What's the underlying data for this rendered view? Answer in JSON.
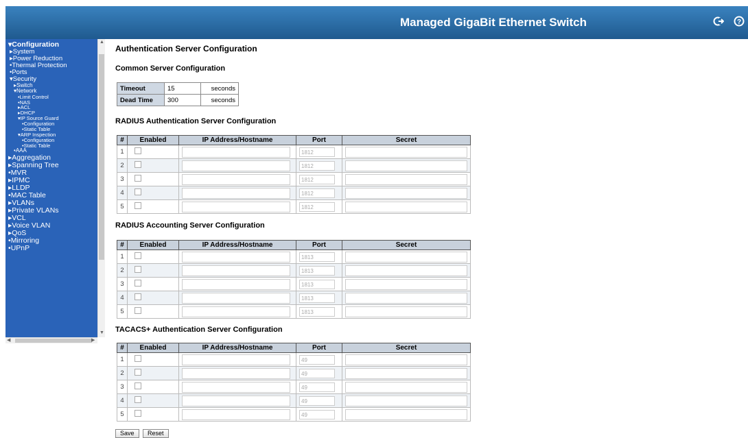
{
  "header": {
    "title": "Managed GigaBit Ethernet Switch"
  },
  "icons": {
    "logout": "logout-icon",
    "help": "help-icon"
  },
  "sidebar": {
    "items": [
      {
        "label": "Configuration",
        "level": 0,
        "bold": true,
        "marker": "▾"
      },
      {
        "label": "System",
        "level": 1,
        "marker": "▸"
      },
      {
        "label": "Power Reduction",
        "level": 1,
        "marker": "▸"
      },
      {
        "label": "Thermal Protection",
        "level": 1,
        "marker": "•"
      },
      {
        "label": "Ports",
        "level": 1,
        "marker": "•"
      },
      {
        "label": "Security",
        "level": 1,
        "marker": "▾"
      },
      {
        "label": "Switch",
        "level": 2,
        "marker": "▸"
      },
      {
        "label": "Network",
        "level": 2,
        "marker": "▾"
      },
      {
        "label": "Limit Control",
        "level": 3,
        "marker": "•"
      },
      {
        "label": "NAS",
        "level": 3,
        "marker": "•"
      },
      {
        "label": "ACL",
        "level": 3,
        "marker": "▸"
      },
      {
        "label": "DHCP",
        "level": 3,
        "marker": "▸"
      },
      {
        "label": "IP Source Guard",
        "level": 3,
        "marker": "▾"
      },
      {
        "label": "Configuration",
        "level": 4,
        "marker": "•"
      },
      {
        "label": "Static Table",
        "level": 4,
        "marker": "•"
      },
      {
        "label": "ARP Inspection",
        "level": 3,
        "marker": "▾"
      },
      {
        "label": "Configuration",
        "level": 4,
        "marker": "•"
      },
      {
        "label": "Static Table",
        "level": 4,
        "marker": "•"
      },
      {
        "label": "AAA",
        "level": 2,
        "marker": "•"
      },
      {
        "label": "Aggregation",
        "level": 0,
        "marker": "▸"
      },
      {
        "label": "Spanning Tree",
        "level": 0,
        "marker": "▸"
      },
      {
        "label": "MVR",
        "level": 0,
        "marker": "•"
      },
      {
        "label": "IPMC",
        "level": 0,
        "marker": "▸"
      },
      {
        "label": "LLDP",
        "level": 0,
        "marker": "▸"
      },
      {
        "label": "MAC Table",
        "level": 0,
        "marker": "•"
      },
      {
        "label": "VLANs",
        "level": 0,
        "marker": "▸"
      },
      {
        "label": "Private VLANs",
        "level": 0,
        "marker": "▸"
      },
      {
        "label": "VCL",
        "level": 0,
        "marker": "▸"
      },
      {
        "label": "Voice VLAN",
        "level": 0,
        "marker": "▸"
      },
      {
        "label": "QoS",
        "level": 0,
        "marker": "▸"
      },
      {
        "label": "Mirroring",
        "level": 0,
        "marker": "•"
      },
      {
        "label": "UPnP",
        "level": 0,
        "marker": "•"
      }
    ]
  },
  "page": {
    "title": "Authentication Server Configuration",
    "common": {
      "heading": "Common Server Configuration",
      "rows": [
        {
          "label": "Timeout",
          "value": "15",
          "unit": "seconds"
        },
        {
          "label": "Dead Time",
          "value": "300",
          "unit": "seconds"
        }
      ]
    },
    "columns": {
      "num": "#",
      "enabled": "Enabled",
      "ip": "IP Address/Hostname",
      "port": "Port",
      "secret": "Secret"
    },
    "radius_auth": {
      "heading": "RADIUS Authentication Server Configuration",
      "rows": [
        {
          "num": "1",
          "port": "1812"
        },
        {
          "num": "2",
          "port": "1812"
        },
        {
          "num": "3",
          "port": "1812"
        },
        {
          "num": "4",
          "port": "1812"
        },
        {
          "num": "5",
          "port": "1812"
        }
      ]
    },
    "radius_acct": {
      "heading": "RADIUS Accounting Server Configuration",
      "rows": [
        {
          "num": "1",
          "port": "1813"
        },
        {
          "num": "2",
          "port": "1813"
        },
        {
          "num": "3",
          "port": "1813"
        },
        {
          "num": "4",
          "port": "1813"
        },
        {
          "num": "5",
          "port": "1813"
        }
      ]
    },
    "tacacs": {
      "heading": "TACACS+ Authentication Server Configuration",
      "rows": [
        {
          "num": "1",
          "port": "49"
        },
        {
          "num": "2",
          "port": "49"
        },
        {
          "num": "3",
          "port": "49"
        },
        {
          "num": "4",
          "port": "49"
        },
        {
          "num": "5",
          "port": "49"
        }
      ]
    },
    "buttons": {
      "save": "Save",
      "reset": "Reset"
    }
  }
}
